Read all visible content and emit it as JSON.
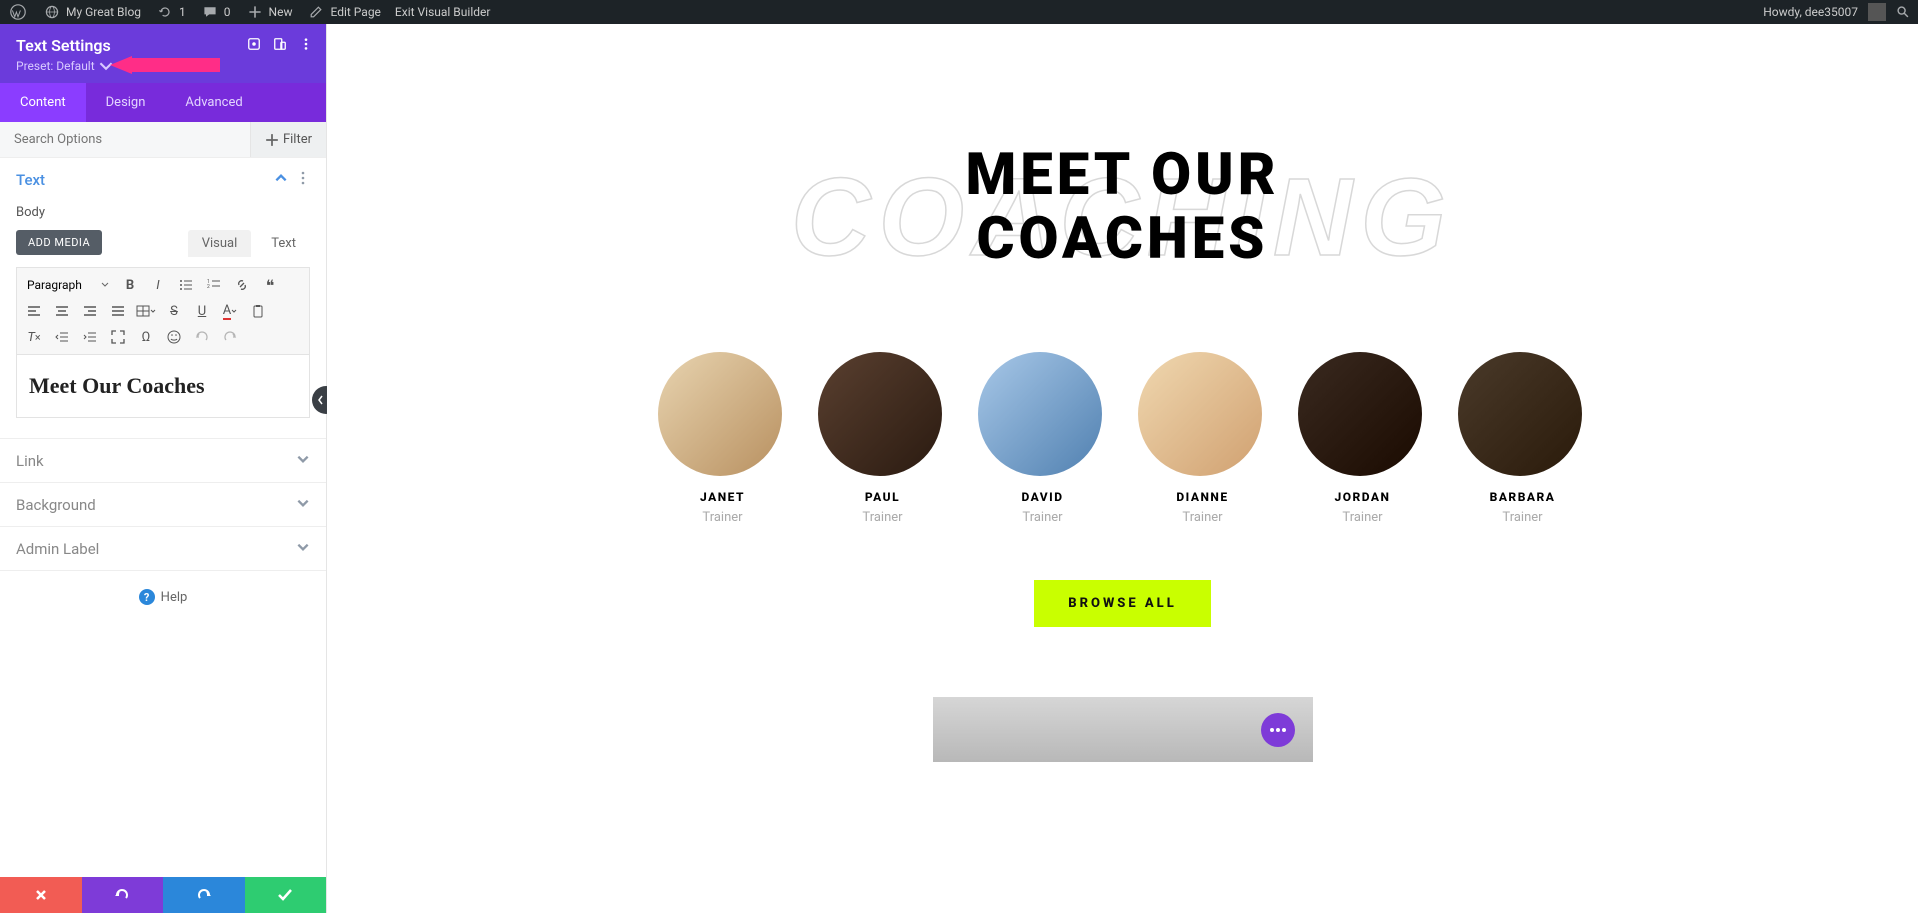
{
  "adminBar": {
    "siteName": "My Great Blog",
    "revisions": "1",
    "comments": "0",
    "new": "New",
    "editPage": "Edit Page",
    "exitBuilder": "Exit Visual Builder",
    "greeting": "Howdy, dee35007"
  },
  "panel": {
    "title": "Text Settings",
    "preset": "Preset: Default",
    "tabs": {
      "content": "Content",
      "design": "Design",
      "advanced": "Advanced"
    },
    "searchPlaceholder": "Search Options",
    "filter": "Filter",
    "sections": {
      "text": "Text",
      "bodyLabel": "Body",
      "addMedia": "ADD MEDIA",
      "visualTab": "Visual",
      "textTab": "Text",
      "formatSelect": "Paragraph",
      "editorContent": "Meet Our Coaches",
      "link": "Link",
      "background": "Background",
      "adminLabel": "Admin Label"
    },
    "help": "Help"
  },
  "page": {
    "bgWord": "COACHING",
    "heroTitle1": "MEET OUR",
    "heroTitle2": "COACHES",
    "coaches": [
      {
        "name": "JANET",
        "role": "Trainer",
        "cls": "ci1"
      },
      {
        "name": "PAUL",
        "role": "Trainer",
        "cls": "ci2"
      },
      {
        "name": "DAVID",
        "role": "Trainer",
        "cls": "ci3"
      },
      {
        "name": "DIANNE",
        "role": "Trainer",
        "cls": "ci4"
      },
      {
        "name": "JORDAN",
        "role": "Trainer",
        "cls": "ci5"
      },
      {
        "name": "BARBARA",
        "role": "Trainer",
        "cls": "ci6"
      }
    ],
    "browseAll": "BROWSE ALL"
  }
}
